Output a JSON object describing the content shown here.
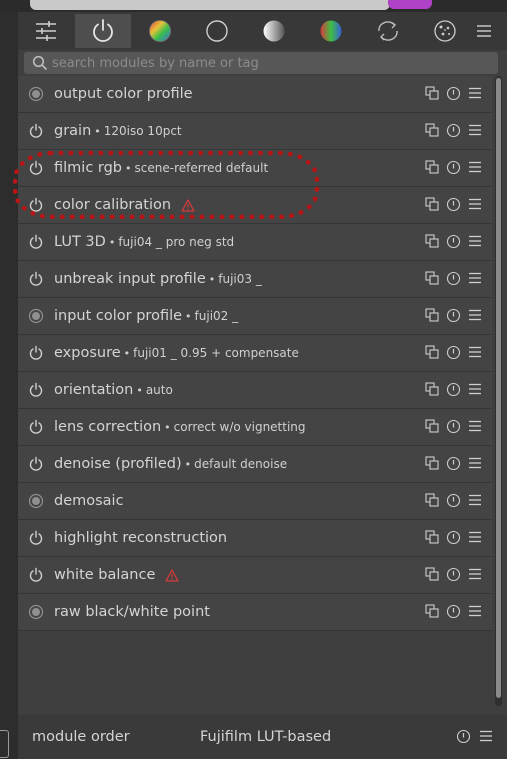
{
  "search": {
    "placeholder": "search modules by name or tag"
  },
  "tabs": [
    {
      "icon": "sliders-icon",
      "active": false
    },
    {
      "icon": "power-icon",
      "active": true
    },
    {
      "icon": "color-wheel-icon",
      "active": false
    },
    {
      "icon": "circle-outline-icon",
      "active": false
    },
    {
      "icon": "gradient-sphere-icon",
      "active": false
    },
    {
      "icon": "rgb-sphere-icon",
      "active": false
    },
    {
      "icon": "refresh-arrows-icon",
      "active": false
    },
    {
      "icon": "effects-icon",
      "active": false
    },
    {
      "icon": "menu-icon",
      "active": false
    }
  ],
  "modules": [
    {
      "label": "output color profile",
      "desc": "",
      "state": "always-on",
      "warning": false
    },
    {
      "label": "grain",
      "desc": "120iso 10pct",
      "state": "on",
      "warning": false
    },
    {
      "label": "filmic rgb",
      "desc": "scene-referred default",
      "state": "on",
      "warning": false
    },
    {
      "label": "color calibration",
      "desc": "",
      "state": "on",
      "warning": true
    },
    {
      "label": "LUT 3D",
      "desc": "fuji04 _ pro neg std",
      "state": "on",
      "warning": false
    },
    {
      "label": "unbreak input profile",
      "desc": "fuji03 _",
      "state": "on",
      "warning": false
    },
    {
      "label": "input color profile",
      "desc": "fuji02 _",
      "state": "always-on",
      "warning": false
    },
    {
      "label": "exposure",
      "desc": "fuji01 _ 0.95 + compensate",
      "state": "on",
      "warning": false
    },
    {
      "label": "orientation",
      "desc": "auto",
      "state": "on",
      "warning": false
    },
    {
      "label": "lens correction",
      "desc": "correct w/o vignetting",
      "state": "on",
      "warning": false
    },
    {
      "label": "denoise (profiled)",
      "desc": "default denoise",
      "state": "on",
      "warning": false
    },
    {
      "label": "demosaic",
      "desc": "",
      "state": "always-on",
      "warning": false
    },
    {
      "label": "highlight reconstruction",
      "desc": "",
      "state": "on",
      "warning": false
    },
    {
      "label": "white balance",
      "desc": "",
      "state": "on",
      "warning": true
    },
    {
      "label": "raw black/white point",
      "desc": "",
      "state": "always-on",
      "warning": false
    }
  ],
  "separator": "•",
  "footer": {
    "label": "module order",
    "value": "Fujifilm LUT-based"
  },
  "colors": {
    "accent_highlight": "#b81616",
    "warning": "#d43a3a"
  }
}
